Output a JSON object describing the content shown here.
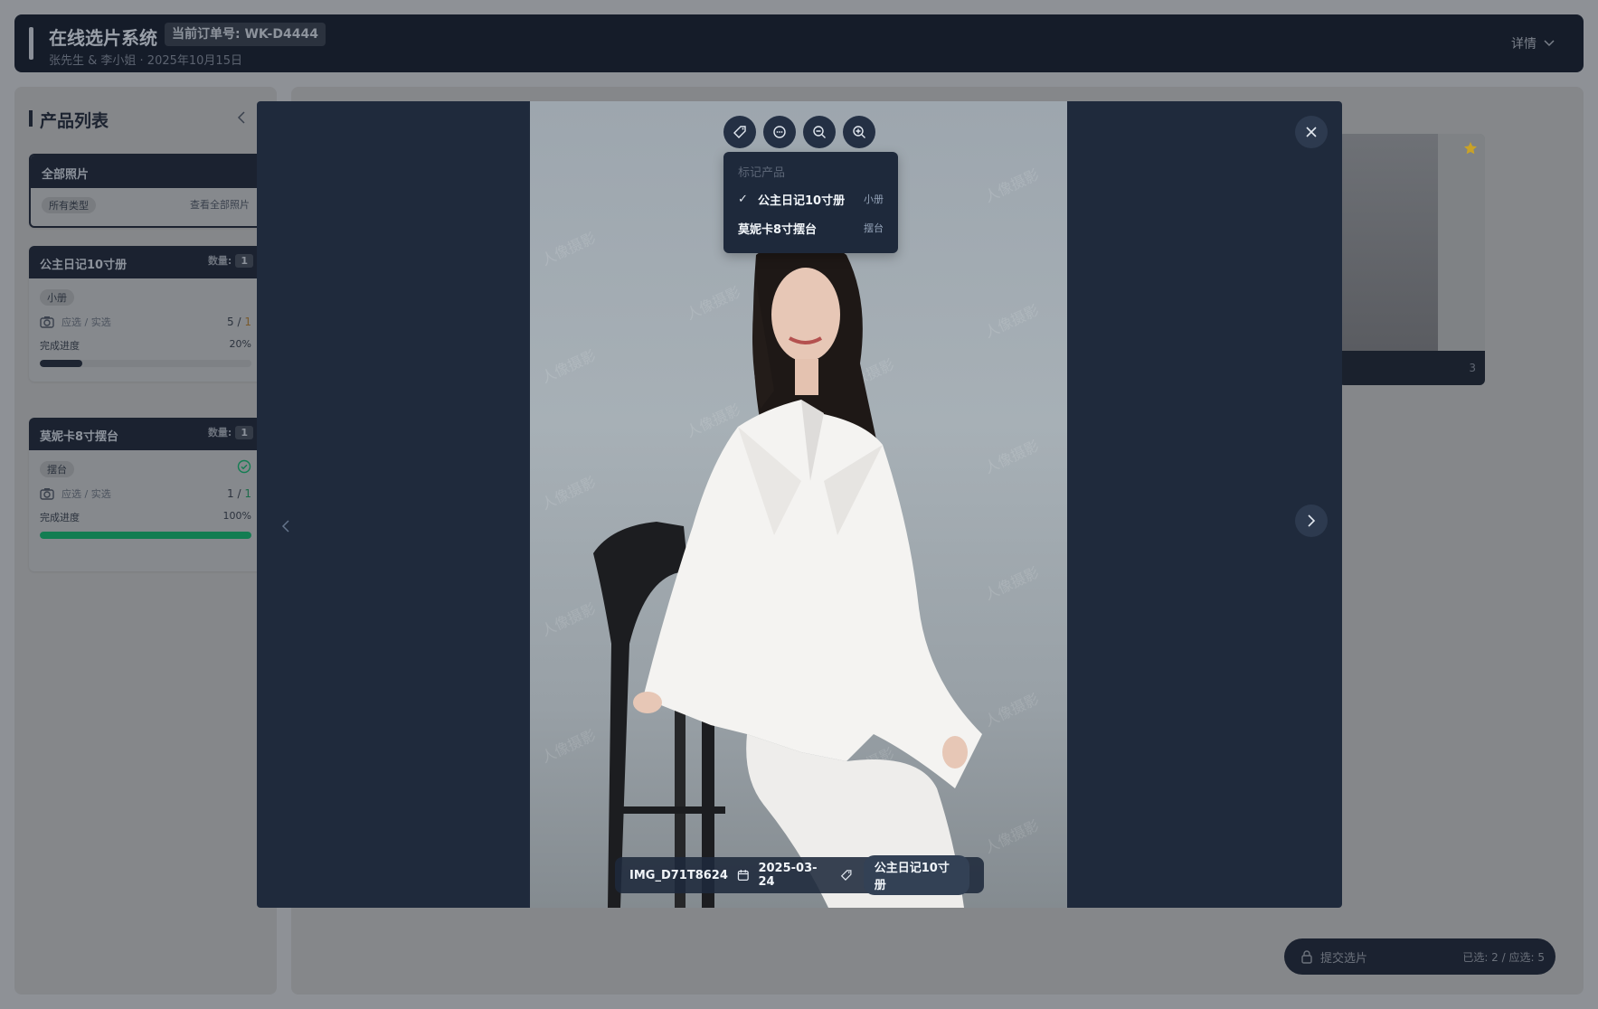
{
  "header": {
    "title": "在线选片系统",
    "order_badge": "当前订单号: WK-D4444",
    "subtitle": "张先生 & 李小姐 · 2025年10月15日",
    "details_label": "详情"
  },
  "sidebar": {
    "title": "产品列表",
    "all_card": {
      "title": "全部照片",
      "tag": "所有类型",
      "link": "查看全部照片"
    },
    "products": [
      {
        "name": "公主日记10寸册",
        "qty_label": "数量:",
        "qty": "1",
        "tag": "小册",
        "select_label": "应选 / 实选",
        "required": "5",
        "sep": "/",
        "selected": "1",
        "progress_label": "完成进度",
        "progress_text": "20%",
        "progress": 0.2,
        "complete": false
      },
      {
        "name": "莫妮卡8寸摆台",
        "qty_label": "数量:",
        "qty": "1",
        "tag": "摆台",
        "select_label": "应选 / 实选",
        "required": "1",
        "sep": "/",
        "selected": "1",
        "progress_label": "完成进度",
        "progress_text": "100%",
        "progress": 1.0,
        "complete": true
      }
    ]
  },
  "main": {
    "photo_card": {
      "number": "3",
      "starred": true
    },
    "submit": {
      "label": "提交选片",
      "stats": "已选: 2 / 应选: 5"
    }
  },
  "viewer": {
    "watermark_text": "人像摄影",
    "tools": [
      {
        "icon": "tag-icon"
      },
      {
        "icon": "comment-icon"
      },
      {
        "icon": "zoom-out-icon"
      },
      {
        "icon": "zoom-in-icon"
      }
    ],
    "tag_menu": {
      "header": "标记产品",
      "items": [
        {
          "label": "公主日记10寸册",
          "type": "小册",
          "checked": true
        },
        {
          "label": "莫妮卡8寸摆台",
          "type": "摆台",
          "checked": false
        }
      ]
    },
    "info": {
      "filename": "IMG_D71T8624",
      "date": "2025-03-24",
      "product": "公主日记10寸册"
    }
  },
  "colors": {
    "dark_navy": "#1b2230",
    "overlay_panel": "#1f2a3c",
    "success_green": "#137d52",
    "star_gold": "#c9a227"
  }
}
